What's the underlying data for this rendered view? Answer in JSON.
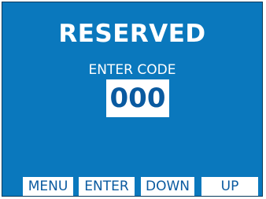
{
  "screen": {
    "title": "RESERVED",
    "prompt": "ENTER CODE",
    "code_value": "000"
  },
  "softkeys": {
    "menu": "MENU",
    "enter": "ENTER",
    "down": "DOWN",
    "up": "UP"
  },
  "colors": {
    "background": "#0a78bd",
    "text": "#ffffff",
    "key_background": "#ffffff",
    "key_text": "#0a5aa0"
  }
}
